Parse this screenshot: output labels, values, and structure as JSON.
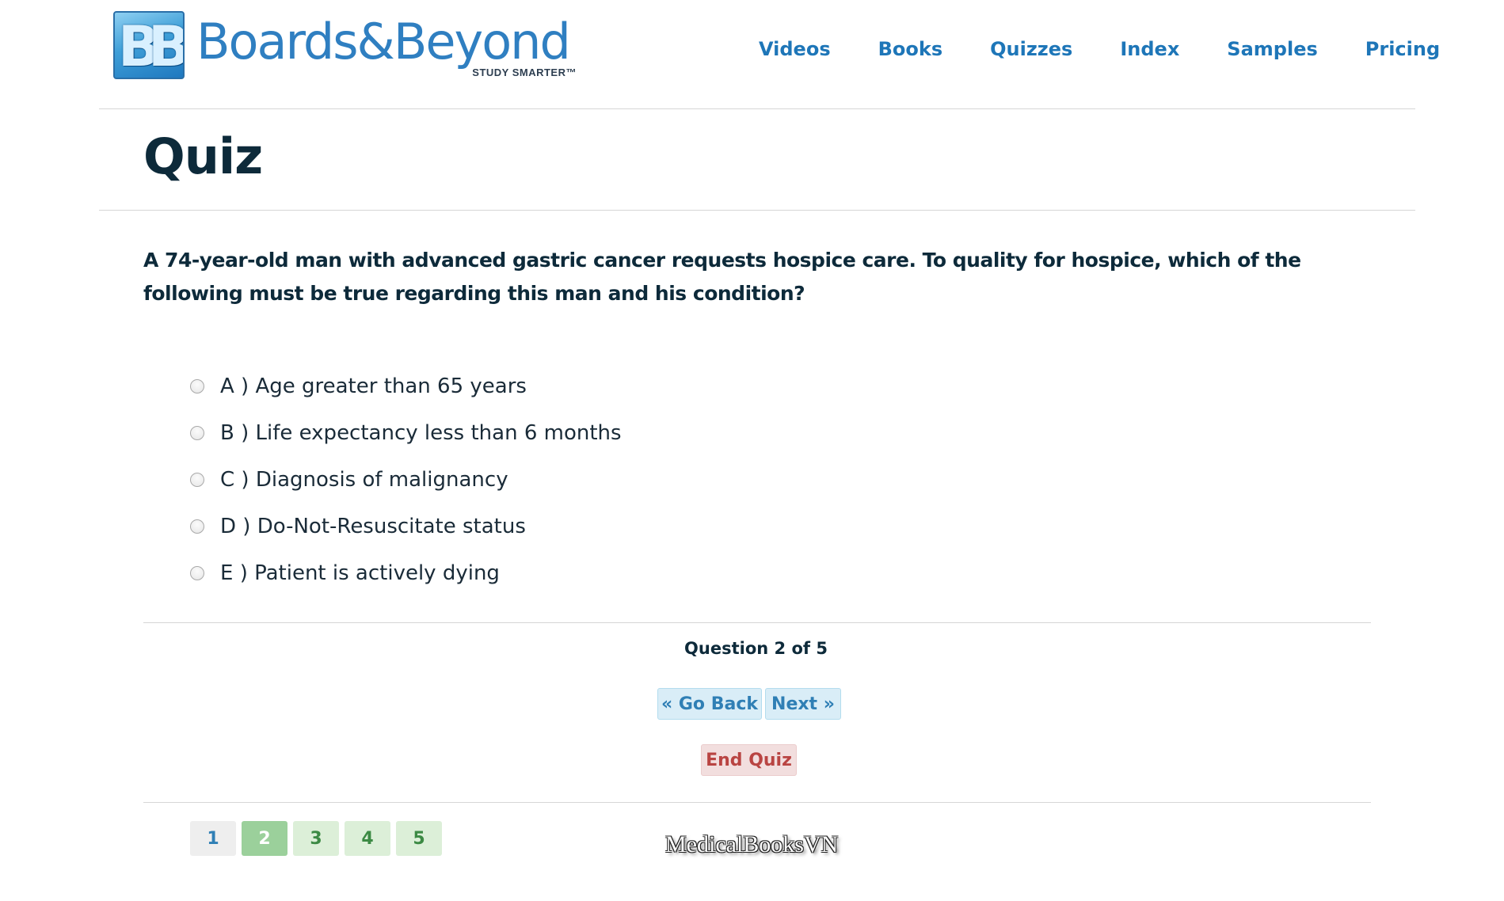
{
  "header": {
    "logo": {
      "mark": "BB",
      "wordmark": "Boards&Beyond",
      "registered": "®",
      "tagline": "STUDY SMARTER™"
    },
    "nav": [
      "Videos",
      "Books",
      "Quizzes",
      "Index",
      "Samples",
      "Pricing"
    ]
  },
  "page_title": "Quiz",
  "question": {
    "text": "A 74-year-old man with advanced gastric cancer requests hospice care. To quality for hospice, which of the following must be true regarding this man and his condition?"
  },
  "options": [
    "A ) Age greater than 65 years",
    "B ) Life expectancy less than 6 months",
    "C ) Diagnosis of malignancy",
    "D ) Do-Not-Resuscitate status",
    "E ) Patient is actively dying"
  ],
  "progress": "Question 2 of 5",
  "buttons": {
    "back": "« Go Back",
    "next": "Next »",
    "end": "End Quiz"
  },
  "pager": [
    "1",
    "2",
    "3",
    "4",
    "5"
  ],
  "watermark": "MedicalBooksVN",
  "colors": {
    "accent": "#1e76b8",
    "title": "#0d2a3a",
    "nav_button_bg": "#d9edf7",
    "end_button_bg": "#f2dede",
    "end_button_text": "#b94442",
    "answered_page": "#9bd09b",
    "pending_page": "#dcefd8"
  }
}
